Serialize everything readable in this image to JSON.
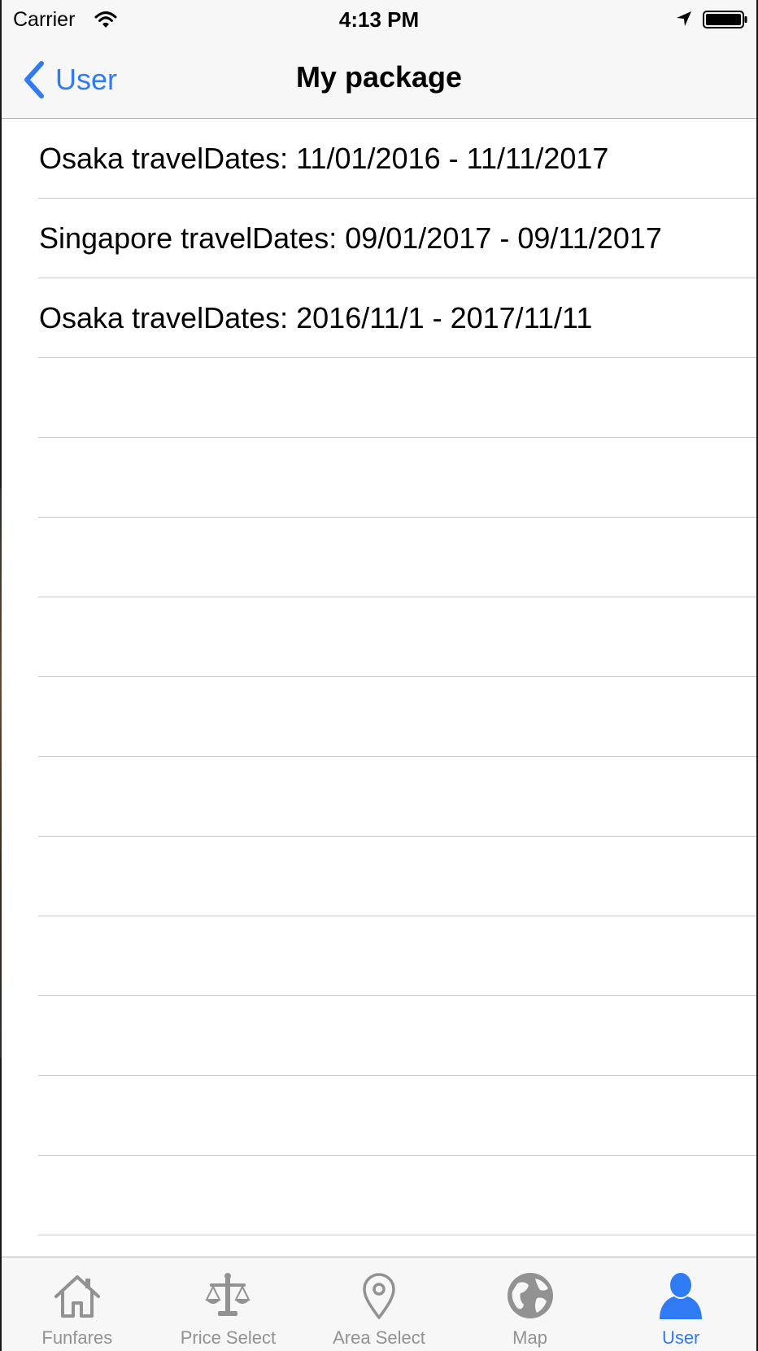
{
  "status_bar": {
    "carrier": "Carrier",
    "time": "4:13 PM"
  },
  "nav": {
    "back_label": "User",
    "title": "My package"
  },
  "packages": [
    {
      "label": "Osaka travelDates: 11/01/2016 - 11/11/2017"
    },
    {
      "label": "Singapore travelDates: 09/01/2017 - 09/11/2017"
    },
    {
      "label": "Osaka travelDates: 2016/11/1 - 2017/11/11"
    }
  ],
  "tabs": [
    {
      "label": "Funfares",
      "icon": "home-icon",
      "active": false
    },
    {
      "label": "Price Select",
      "icon": "scale-icon",
      "active": false
    },
    {
      "label": "Area Select",
      "icon": "map-pin-icon",
      "active": false
    },
    {
      "label": "Map",
      "icon": "globe-icon",
      "active": false
    },
    {
      "label": "User",
      "icon": "user-icon",
      "active": true
    }
  ],
  "colors": {
    "accent": "#2f7bf3",
    "inactive_tab": "#929292",
    "bar_background": "#f7f7f7",
    "separator": "#c8c7cc"
  }
}
